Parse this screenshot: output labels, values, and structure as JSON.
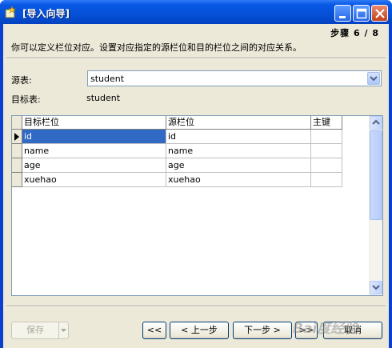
{
  "window": {
    "title": "[导入向导]",
    "step": "步骤 6 / 8",
    "instruction": "你可以定义栏位对应。设置对应指定的源栏位和目的栏位之间的对应关系。"
  },
  "source_table": {
    "label": "源表:",
    "value": "student"
  },
  "target_table": {
    "label": "目标表:",
    "value": "student"
  },
  "grid": {
    "headers": [
      "目标栏位",
      "源栏位",
      "主键"
    ],
    "rows": [
      {
        "target": "id",
        "source": "id",
        "pk": ""
      },
      {
        "target": "name",
        "source": "name",
        "pk": ""
      },
      {
        "target": "age",
        "source": "age",
        "pk": ""
      },
      {
        "target": "xuehao",
        "source": "xuehao",
        "pk": ""
      }
    ],
    "selected_row": 0
  },
  "buttons": {
    "save": "保存",
    "first": "<<",
    "prev": "< 上一步",
    "next": "下一步 >",
    "last": ">>",
    "cancel": "取消"
  },
  "watermark": "Bai度经验",
  "colors": {
    "titlebar": "#0551d8",
    "selection": "#316ac5",
    "face": "#ece9d8"
  },
  "icons": {
    "app": "wizard-icon",
    "minimize": "minimize-icon",
    "maximize": "maximize-icon",
    "close": "close-icon"
  }
}
